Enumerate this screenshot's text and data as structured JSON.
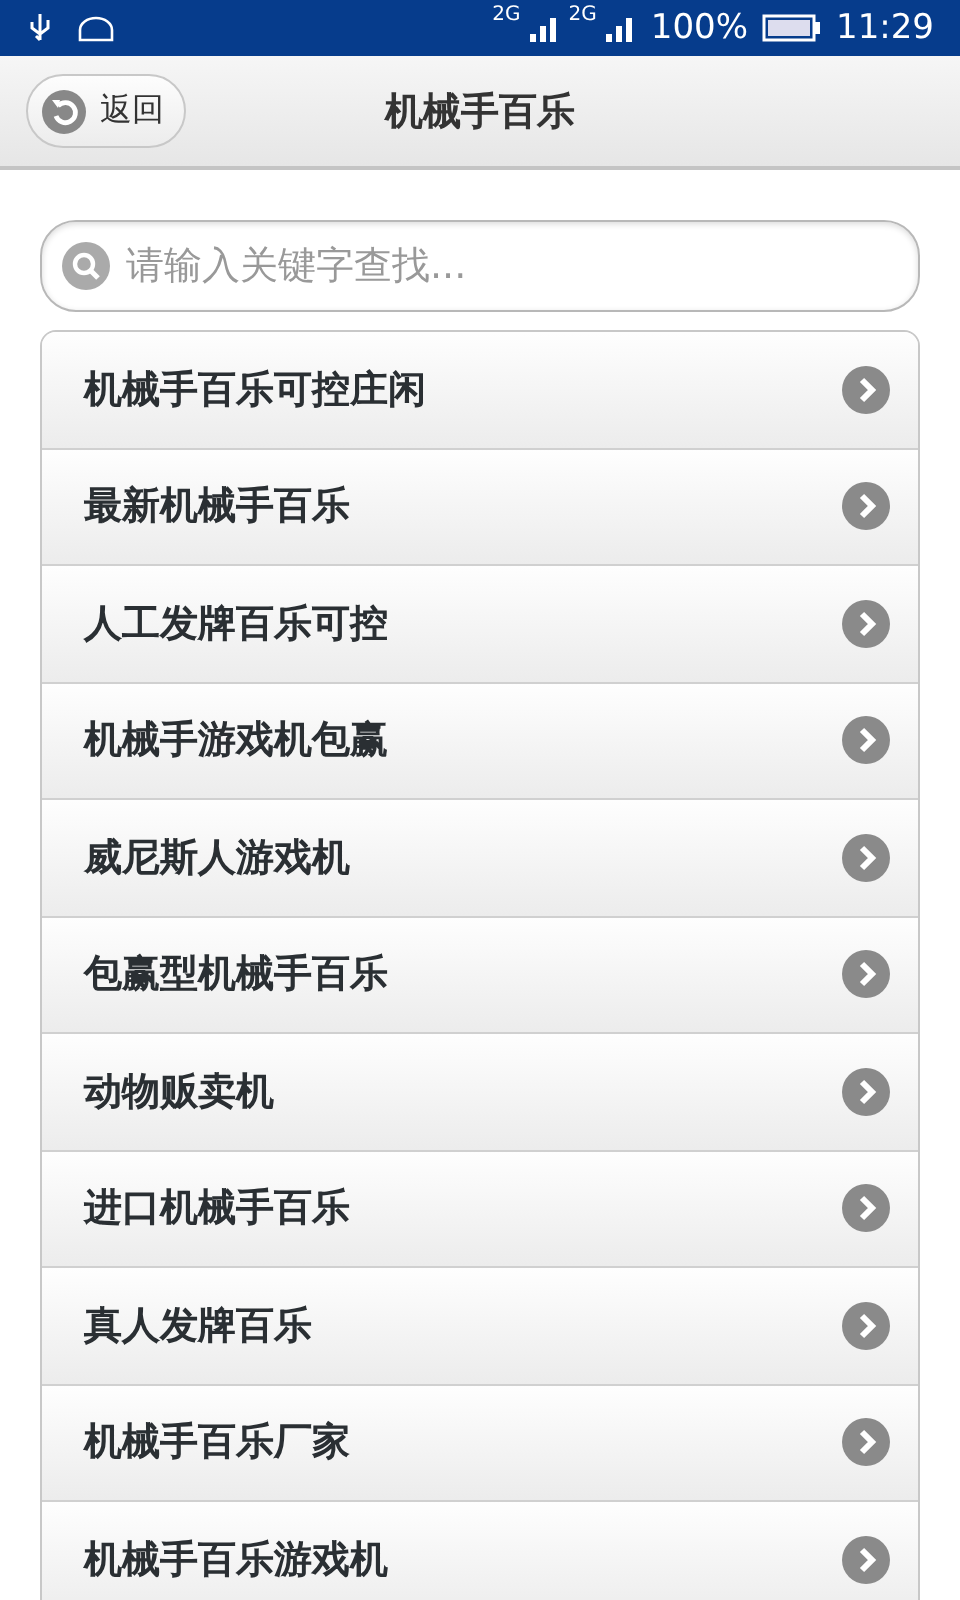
{
  "status_bar": {
    "network_1": "2G",
    "network_2": "2G",
    "battery": "100%",
    "time": "11:29"
  },
  "header": {
    "back_label": "返回",
    "title": "机械手百乐"
  },
  "search": {
    "placeholder": "请输入关键字查找..."
  },
  "items": [
    {
      "label": "机械手百乐可控庄闲"
    },
    {
      "label": "最新机械手百乐"
    },
    {
      "label": "人工发牌百乐可控"
    },
    {
      "label": "机械手游戏机包赢"
    },
    {
      "label": "威尼斯人游戏机"
    },
    {
      "label": "包赢型机械手百乐"
    },
    {
      "label": "动物贩卖机"
    },
    {
      "label": "进口机械手百乐"
    },
    {
      "label": "真人发牌百乐"
    },
    {
      "label": "机械手百乐厂家"
    },
    {
      "label": "机械手百乐游戏机"
    }
  ]
}
